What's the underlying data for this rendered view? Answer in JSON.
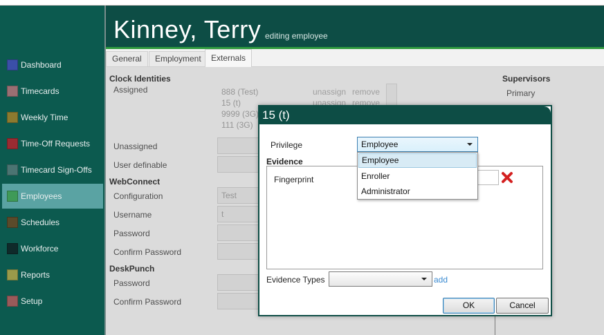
{
  "sidebar": {
    "items": [
      {
        "label": "Dashboard",
        "color": "#3b4fa8"
      },
      {
        "label": "Timecards",
        "color": "#9a6f73"
      },
      {
        "label": "Weekly Time",
        "color": "#8c7a2f"
      },
      {
        "label": "Time-Off Requests",
        "color": "#9a2b32"
      },
      {
        "label": "Timecard Sign-Offs",
        "color": "#4b7472"
      },
      {
        "label": "Employees",
        "color": "#3f9a57"
      },
      {
        "label": "Schedules",
        "color": "#5a4a2a"
      },
      {
        "label": "Workforce",
        "color": "#0f2a2a"
      },
      {
        "label": "Reports",
        "color": "#9a9a4a"
      },
      {
        "label": "Setup",
        "color": "#9a5a5a"
      }
    ],
    "active_index": 5
  },
  "header": {
    "name": "Kinney, Terry",
    "subtitle": "editing employee"
  },
  "tabs": [
    {
      "label": "General"
    },
    {
      "label": "Employment"
    },
    {
      "label": "Externals"
    }
  ],
  "form": {
    "clock_identities": "Clock Identities",
    "assigned": "Assigned",
    "assigned_items": [
      {
        "name": "888 (Test)",
        "action1": "unassign",
        "action2": "remove"
      },
      {
        "name": "15 (t)",
        "action1": "unassign",
        "action2": "remove"
      },
      {
        "name": "9999 (3G)"
      },
      {
        "name": "111 (3G)"
      }
    ],
    "unassigned": "Unassigned",
    "user_definable": "User definable",
    "webconnect": "WebConnect",
    "configuration": "Configuration",
    "configuration_value": "Test",
    "username": "Username",
    "username_value": "t",
    "password": "Password",
    "confirm_password": "Confirm Password",
    "deskpunch": "DeskPunch",
    "dp_password": "Password",
    "dp_confirm_password": "Confirm Password",
    "supervisors": "Supervisors",
    "primary": "Primary"
  },
  "modal": {
    "title": "15 (t)",
    "privilege_label": "Privilege",
    "privilege_value": "Employee",
    "privilege_options": [
      "Employee",
      "Enroller",
      "Administrator"
    ],
    "evidence_label": "Evidence",
    "evidence_items": [
      {
        "label": "Fingerprint"
      }
    ],
    "evidence_types_label": "Evidence Types",
    "evidence_types_value": "",
    "add_label": "add",
    "ok_label": "OK",
    "cancel_label": "Cancel"
  }
}
